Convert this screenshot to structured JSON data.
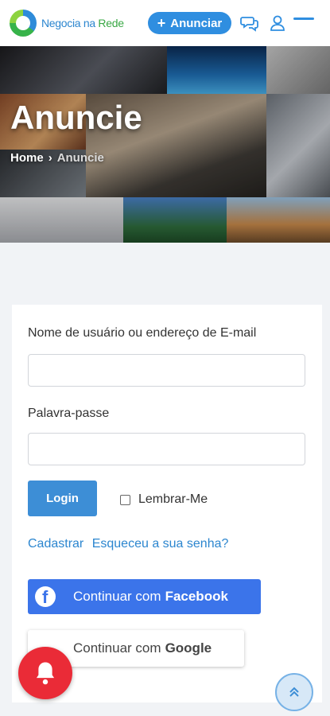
{
  "header": {
    "logo_text_1": "Negocia na",
    "logo_text_2": "Rede",
    "anunciar_label": "Anunciar",
    "icons": [
      "chat-icon",
      "user-icon",
      "menu-icon"
    ]
  },
  "hero": {
    "title": "Anuncie",
    "breadcrumb_home": "Home",
    "breadcrumb_current": "Anuncie"
  },
  "login": {
    "username_label": "Nome de usuário ou endereço de E-mail",
    "username_value": "",
    "password_label": "Palavra-passe",
    "password_value": "",
    "login_button": "Login",
    "remember_label": "Lembrar-Me",
    "remember_checked": false,
    "register_link": "Cadastrar",
    "forgot_link": "Esqueceu a sua senha?",
    "facebook_prefix": "Continuar com",
    "facebook_bold": "Facebook",
    "google_prefix": "Continuar com",
    "google_bold": "Google"
  },
  "colors": {
    "brand_blue": "#2f8ee0",
    "facebook_blue": "#3b74ea",
    "bell_red": "#ea2b37",
    "link_blue": "#2c86cf"
  }
}
